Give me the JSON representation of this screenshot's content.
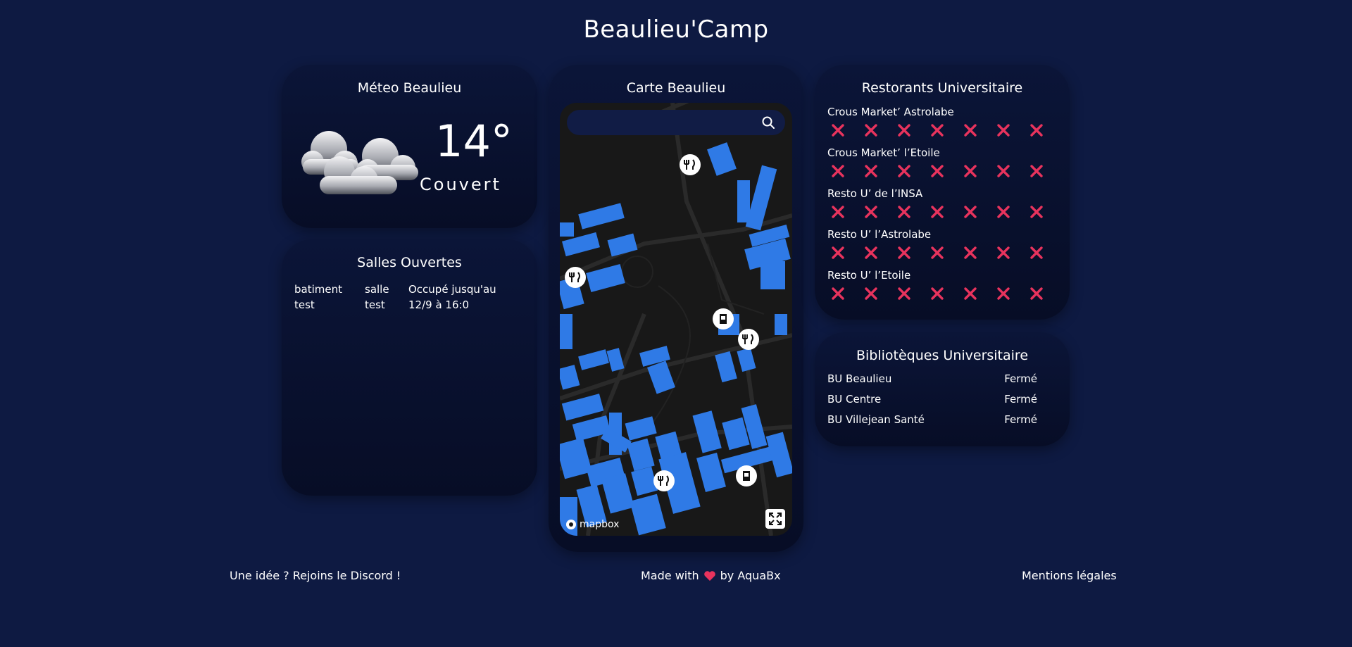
{
  "site": {
    "title": "Beaulieu'Camp"
  },
  "weather": {
    "title": "Méteo Beaulieu",
    "temperature": "14°",
    "condition": "Couvert"
  },
  "rooms": {
    "title": "Salles Ouvertes",
    "headers": [
      "batiment",
      "salle",
      "Occupé jusqu'au"
    ],
    "rows": [
      [
        "test",
        "test",
        "12/9 à 16:0"
      ]
    ]
  },
  "map": {
    "title": "Carte Beaulieu",
    "attribution": "mapbox",
    "building_color": "#2f7ae6",
    "background_color": "#181818"
  },
  "restaurants": {
    "title": "Restorants Universitaire",
    "status_icon": "x-icon",
    "status_color": "#e8335d",
    "items": [
      {
        "name": "Crous Market’ Astrolabe",
        "days": 7
      },
      {
        "name": "Crous Market’ l’Etoile",
        "days": 7
      },
      {
        "name": "Resto U’ de l’INSA",
        "days": 7
      },
      {
        "name": "Resto U’ l’Astrolabe",
        "days": 7
      },
      {
        "name": "Resto U’ l’Etoile",
        "days": 7
      }
    ]
  },
  "libraries": {
    "title": "Bibliotèques Universitaire",
    "items": [
      {
        "name": "BU Beaulieu",
        "status": "Fermé"
      },
      {
        "name": "BU Centre",
        "status": "Fermé"
      },
      {
        "name": "BU Villejean Santé",
        "status": "Fermé"
      }
    ]
  },
  "footer": {
    "discord": "Une idée ? Rejoins le Discord !",
    "made_with": "Made with",
    "by": "by AquaBx",
    "legal": "Mentions légales"
  }
}
